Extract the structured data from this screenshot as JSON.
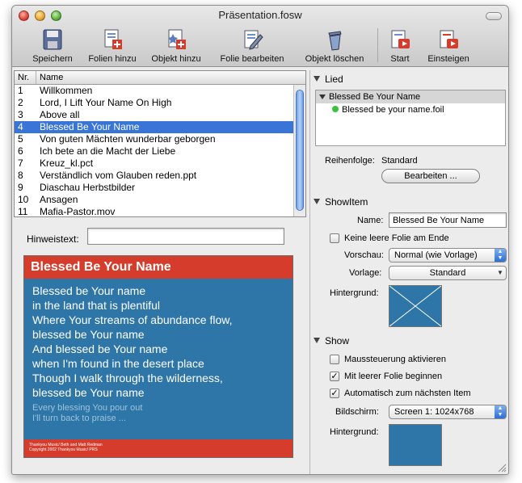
{
  "window": {
    "title": "Präsentation.fosw"
  },
  "toolbar": {
    "save": "Speichern",
    "add_slides": "Folien hinzu",
    "add_object": "Objekt hinzu",
    "edit_slide": "Folie bearbeiten",
    "delete_object": "Objekt löschen",
    "start": "Start",
    "enter": "Einsteigen"
  },
  "list": {
    "headers": {
      "nr": "Nr.",
      "name": "Name"
    },
    "rows": [
      {
        "nr": "1",
        "name": "Willkommen"
      },
      {
        "nr": "2",
        "name": "Lord, I Lift Your Name On High"
      },
      {
        "nr": "3",
        "name": "Above all"
      },
      {
        "nr": "4",
        "name": "Blessed Be Your Name"
      },
      {
        "nr": "5",
        "name": "Von guten Mächten wunderbar geborgen"
      },
      {
        "nr": "6",
        "name": "Ich bete an die Macht der Liebe"
      },
      {
        "nr": "7",
        "name": "Kreuz_kl.pct"
      },
      {
        "nr": "8",
        "name": "Verständlich vom Glauben reden.ppt"
      },
      {
        "nr": "9",
        "name": "Diaschau Herbstbilder"
      },
      {
        "nr": "10",
        "name": "Ansagen"
      },
      {
        "nr": "11",
        "name": "Mafia-Pastor.mov"
      }
    ]
  },
  "hint": {
    "label": "Hinweistext:",
    "value": ""
  },
  "preview": {
    "title": "Blessed Be Your Name",
    "lines": [
      "Blessed be Your name",
      "in the land that is plentiful",
      "Where Your streams of abundance flow,",
      "blessed be Your name",
      "And blessed be Your name",
      "when I'm found in the desert place",
      "Though I walk through the wilderness,",
      "blessed be Your name"
    ],
    "next_lines": [
      "Every blessing You pour out",
      "I'll turn back to praise ..."
    ],
    "footer_lines": [
      "Thankyou Music/ Beth and Matt Redman",
      "Copyright 2002 Thankyou Music/ PRS"
    ]
  },
  "lied": {
    "section_title": "Lied",
    "tree_parent": "Blessed Be Your Name",
    "tree_child": "Blessed be your name.foil",
    "order_label": "Reihenfolge:",
    "order_value": "Standard",
    "edit_button": "Bearbeiten ..."
  },
  "showitem": {
    "section_title": "ShowItem",
    "name_label": "Name:",
    "name_value": "Blessed Be Your Name",
    "empty_slide_label": "Keine leere Folie am Ende",
    "empty_slide_checked": false,
    "preview_label": "Vorschau:",
    "preview_value": "Normal (wie Vorlage)",
    "template_label": "Vorlage:",
    "template_value": "Standard",
    "background_label": "Hintergrund:"
  },
  "show": {
    "section_title": "Show",
    "mouse_label": "Maussteuerung aktivieren",
    "mouse_checked": false,
    "begin_empty_label": "Mit leerer Folie beginnen",
    "begin_empty_checked": true,
    "auto_next_label": "Automatisch zum nächsten Item",
    "auto_next_checked": true,
    "screen_label": "Bildschirm:",
    "screen_value": "Screen 1: 1024x768",
    "background_label": "Hintergrund:"
  },
  "colors": {
    "accent": "#3875d7",
    "slide_blue": "#2e75a8",
    "slide_red": "#d63c2c"
  }
}
